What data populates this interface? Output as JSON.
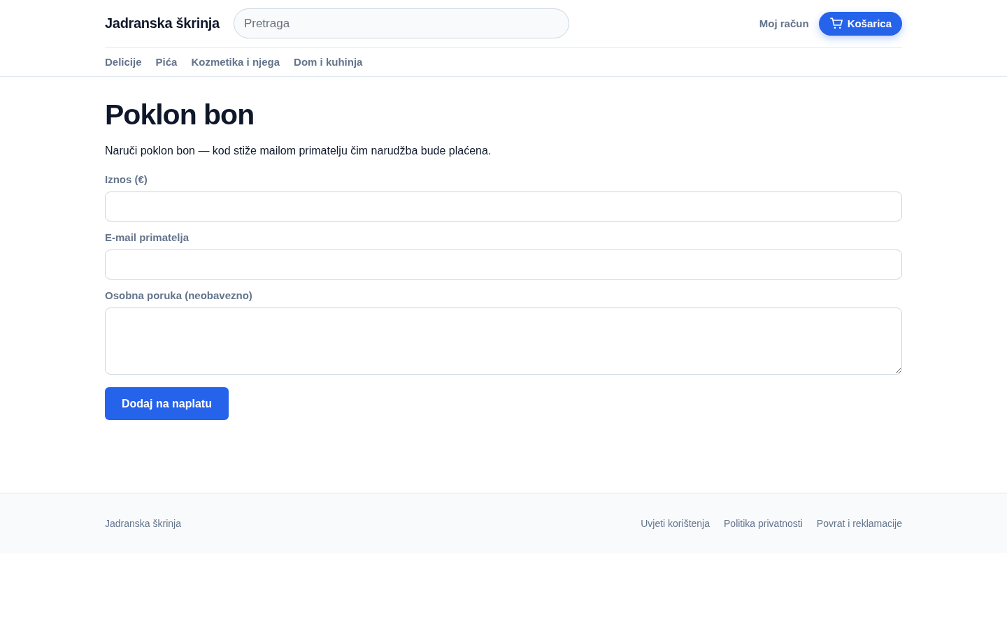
{
  "header": {
    "logo": "Jadranska škrinja",
    "search": {
      "placeholder": "Pretraga"
    },
    "account_link": "Moj račun",
    "cart_button": "Košarica"
  },
  "nav": {
    "items": [
      "Delicije",
      "Pića",
      "Kozmetika i njega",
      "Dom i kuhinja"
    ]
  },
  "page": {
    "title": "Poklon bon",
    "intro": "Naruči poklon bon — kod stiže mailom primatelju čim narudžba bude plaćena.",
    "fields": [
      {
        "kind": "input",
        "label": "Iznos (€)"
      },
      {
        "kind": "input",
        "label": "E-mail primatelja"
      },
      {
        "kind": "textarea",
        "label": "Osobna poruka (neobavezno)"
      }
    ],
    "submit_button": "Dodaj na naplatu"
  },
  "footer": {
    "brand": "Jadranska škrinja",
    "links": [
      "Uvjeti korištenja",
      "Politika privatnosti",
      "Povrat i reklamacije"
    ]
  }
}
